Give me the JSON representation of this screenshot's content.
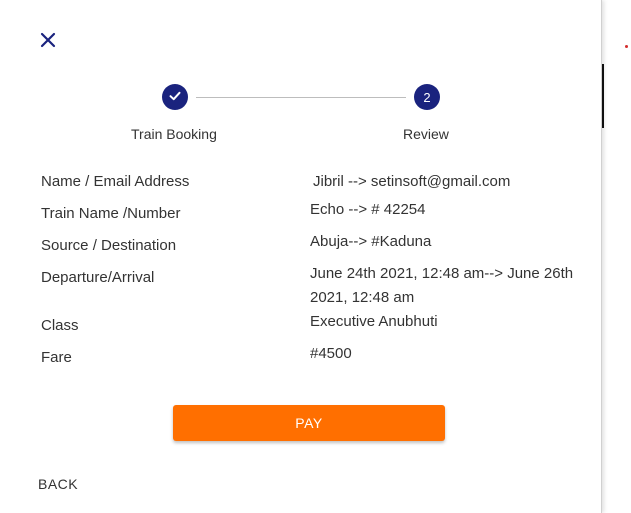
{
  "stepper": {
    "steps": [
      {
        "label": "Train Booking",
        "state": "completed",
        "icon": "check-icon"
      },
      {
        "label": "Review",
        "state": "active",
        "number": "2"
      }
    ],
    "active_color": "#1a237e"
  },
  "details": [
    {
      "label": "Name / Email Address",
      "value": "Jibril --> setinsoft@gmail.com"
    },
    {
      "label": "Train Name /Number",
      "value": "Echo --> # 42254"
    },
    {
      "label": "Source / Destination",
      "value": "Abuja--> #Kaduna"
    },
    {
      "label": "Departure/Arrival",
      "value": "June 24th 2021, 12:48 am--> June 26th 2021, 12:48 am"
    },
    {
      "label": "Class",
      "value": "Executive Anubhuti"
    },
    {
      "label": "Fare",
      "value": "#4500"
    }
  ],
  "actions": {
    "pay_label": "PAY",
    "back_label": "BACK",
    "pay_color": "#ff6f00"
  },
  "icons": {
    "close": "close-icon",
    "check": "check-icon"
  }
}
